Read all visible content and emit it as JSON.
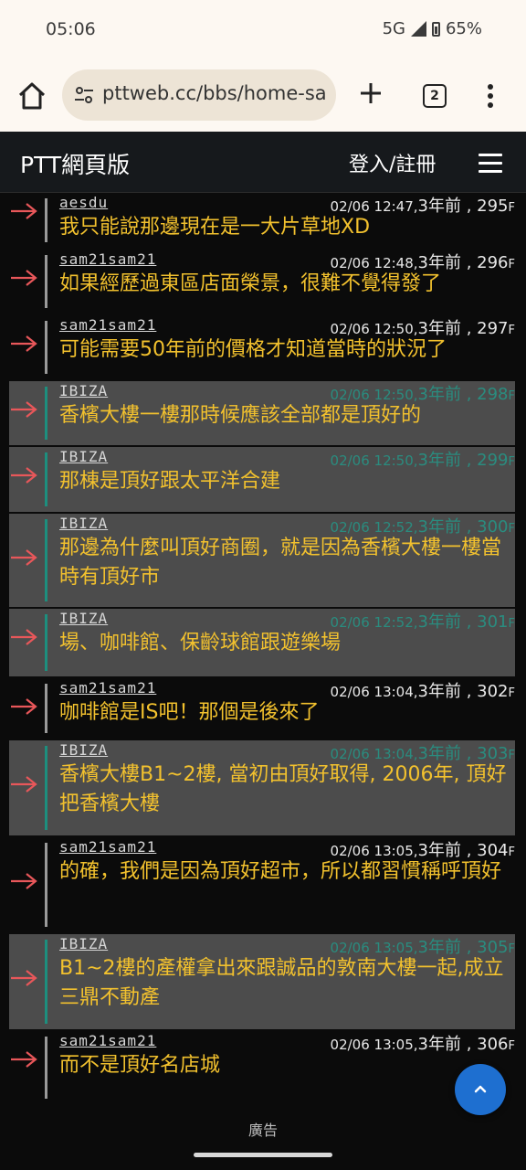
{
  "status_bar": {
    "time": "05:06",
    "network": "5G",
    "battery": "65%"
  },
  "browser": {
    "url": "pttweb.cc/bbs/home-sa",
    "tab_count": "2"
  },
  "site": {
    "title": "PTT網頁版",
    "login": "登入/註冊"
  },
  "comments": [
    {
      "user": "aesdu",
      "datetime": "02/06 12:47,",
      "ago": "3年前 , 295",
      "floor": "F",
      "text": "我只能說那邊現在是一大片草地XD",
      "op": false
    },
    {
      "user": "sam21sam21",
      "datetime": "02/06 12:48,",
      "ago": "3年前 , 296",
      "floor": "F",
      "text": "如果經歷過東區店面榮景，很難不覺得發了",
      "op": false
    },
    {
      "user": "sam21sam21",
      "datetime": "02/06 12:50,",
      "ago": "3年前 , 297",
      "floor": "F",
      "text": "可能需要50年前的價格才知道當時的狀況了",
      "op": false
    },
    {
      "user": "IBIZA",
      "datetime": "02/06 12:50,",
      "ago": "3年前 , 298",
      "floor": "F",
      "text": "香檳大樓一樓那時候應該全部都是頂好的",
      "op": true
    },
    {
      "user": "IBIZA",
      "datetime": "02/06 12:50,",
      "ago": "3年前 , 299",
      "floor": "F",
      "text": "那棟是頂好跟太平洋合建",
      "op": true
    },
    {
      "user": "IBIZA",
      "datetime": "02/06 12:52,",
      "ago": "3年前 , 300",
      "floor": "F",
      "text": "那邊為什麼叫頂好商圈，就是因為香檳大樓一樓當時有頂好市",
      "op": true
    },
    {
      "user": "IBIZA",
      "datetime": "02/06 12:52,",
      "ago": "3年前 , 301",
      "floor": "F",
      "text": "場、咖啡館、保齡球館跟遊樂場",
      "op": true
    },
    {
      "user": "sam21sam21",
      "datetime": "02/06 13:04,",
      "ago": "3年前 , 302",
      "floor": "F",
      "text": "咖啡館是IS吧！那個是後來了",
      "op": false
    },
    {
      "user": "IBIZA",
      "datetime": "02/06 13:04,",
      "ago": "3年前 , 303",
      "floor": "F",
      "text": "香檳大樓B1~2樓, 當初由頂好取得, 2006年, 頂好把香檳大樓",
      "op": true
    },
    {
      "user": "sam21sam21",
      "datetime": "02/06 13:05,",
      "ago": "3年前 , 304",
      "floor": "F",
      "text": "的確，我們是因為頂好超市，所以都習慣稱呼頂好",
      "op": false
    },
    {
      "user": "IBIZA",
      "datetime": "02/06 13:05,",
      "ago": "3年前 , 305",
      "floor": "F",
      "text": "B1~2樓的產權拿出來跟誠品的敦南大樓一起,成立三鼎不動產",
      "op": true
    },
    {
      "user": "sam21sam21",
      "datetime": "02/06 13:05,",
      "ago": "3年前 , 306",
      "floor": "F",
      "text": "而不是頂好名店城",
      "op": false
    }
  ],
  "ad": {
    "label": "廣告"
  },
  "colors": {
    "text": "#f2c12e",
    "op_bg": "#4c4c4c",
    "op_bar": "#1d8f7e",
    "arrow": "#e8575a",
    "fab": "#1e6fd0"
  },
  "icons": {
    "home": "home-icon",
    "tune": "tune-icon",
    "plus": "plus-icon",
    "menu": "hamburger-icon",
    "arrow": "push-arrow-icon",
    "fab": "chevron-up-icon"
  }
}
